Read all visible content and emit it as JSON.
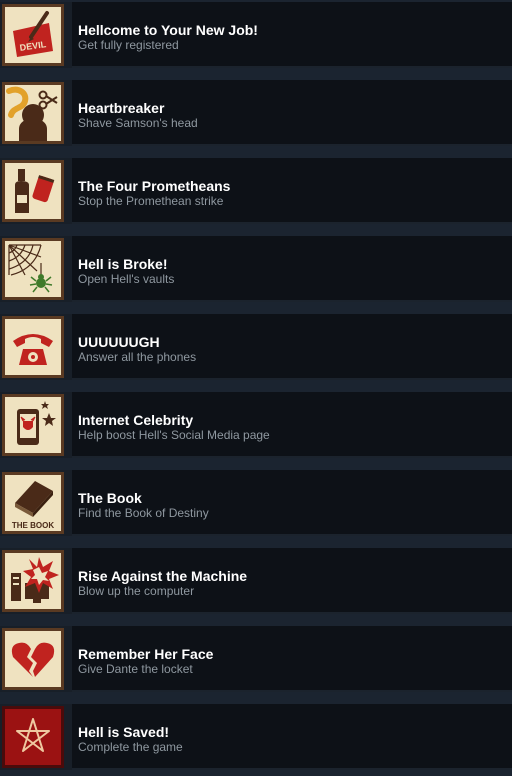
{
  "achievements": [
    {
      "title": "Hellcome to Your New Job!",
      "desc": "Get fully registered",
      "icon": "devil-contract-icon",
      "icon_label": "DEVIL"
    },
    {
      "title": "Heartbreaker",
      "desc": "Shave Samson's head",
      "icon": "scissors-hair-icon"
    },
    {
      "title": "The Four Prometheans",
      "desc": "Stop the Promethean strike",
      "icon": "bottle-can-icon"
    },
    {
      "title": "Hell is Broke!",
      "desc": "Open Hell's vaults",
      "icon": "spider-web-icon"
    },
    {
      "title": "UUUUUUGH",
      "desc": "Answer all the phones",
      "icon": "telephone-icon"
    },
    {
      "title": "Internet Celebrity",
      "desc": "Help boost Hell's Social Media page",
      "icon": "smartphone-stars-icon"
    },
    {
      "title": "The Book",
      "desc": "Find the Book of Destiny",
      "icon": "book-icon",
      "icon_label": "THE BOOK"
    },
    {
      "title": "Rise Against the Machine",
      "desc": "Blow up the computer",
      "icon": "computer-explosion-icon"
    },
    {
      "title": "Remember Her Face",
      "desc": "Give Dante the locket",
      "icon": "broken-heart-icon"
    },
    {
      "title": "Hell is Saved!",
      "desc": "Complete the game",
      "icon": "pentagram-icon"
    }
  ],
  "colors": {
    "icon_bg": "#efe2c0",
    "icon_border": "#5a3a22",
    "icon_accent_red": "#c0231f",
    "icon_dark": "#4a2a18",
    "row_bg": "#0d1117",
    "title_color": "#ffffff",
    "desc_color": "#8f98a0"
  }
}
